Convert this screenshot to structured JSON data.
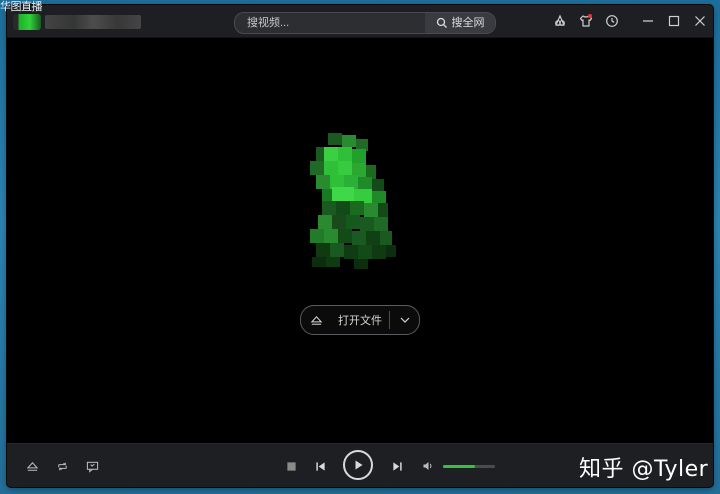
{
  "desktop": {
    "title_fragment": "华图直播"
  },
  "titlebar": {
    "search_placeholder": "搜视频...",
    "search_button": "搜全网"
  },
  "player": {
    "open_file_label": "打开文件"
  },
  "controls": {
    "volume_level": 0.62
  },
  "watermark": "知乎 @Tyler",
  "colors": {
    "accent": "#33c43b",
    "window_bg": "#000000",
    "bar_bg": "#1e1f22",
    "badge": "#e33333"
  }
}
